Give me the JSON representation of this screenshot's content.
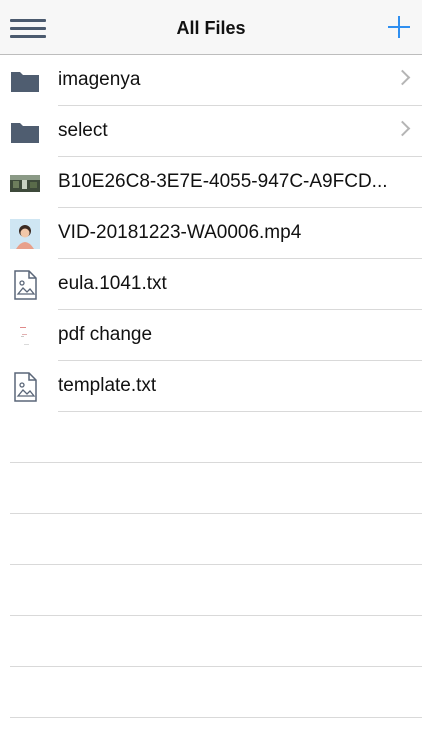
{
  "navbar": {
    "title": "All Files",
    "menu_icon": "hamburger-menu-icon",
    "add_icon": "plus-icon",
    "accent_color": "#2f8ff0"
  },
  "files": [
    {
      "name": "imagenya",
      "kind": "folder",
      "icon": "folder-icon"
    },
    {
      "name": "select",
      "kind": "folder",
      "icon": "folder-icon"
    },
    {
      "name": "B10E26C8-3E7E-4055-947C-A9FCD...",
      "kind": "image",
      "icon": "image-thumbnail-icon"
    },
    {
      "name": "VID-20181223-WA0006.mp4",
      "kind": "video",
      "icon": "video-thumbnail-icon"
    },
    {
      "name": "eula.1041.txt",
      "kind": "text",
      "icon": "file-icon"
    },
    {
      "name": "pdf change",
      "kind": "document",
      "icon": "document-thumbnail-icon"
    },
    {
      "name": "template.txt",
      "kind": "text",
      "icon": "file-icon"
    }
  ]
}
